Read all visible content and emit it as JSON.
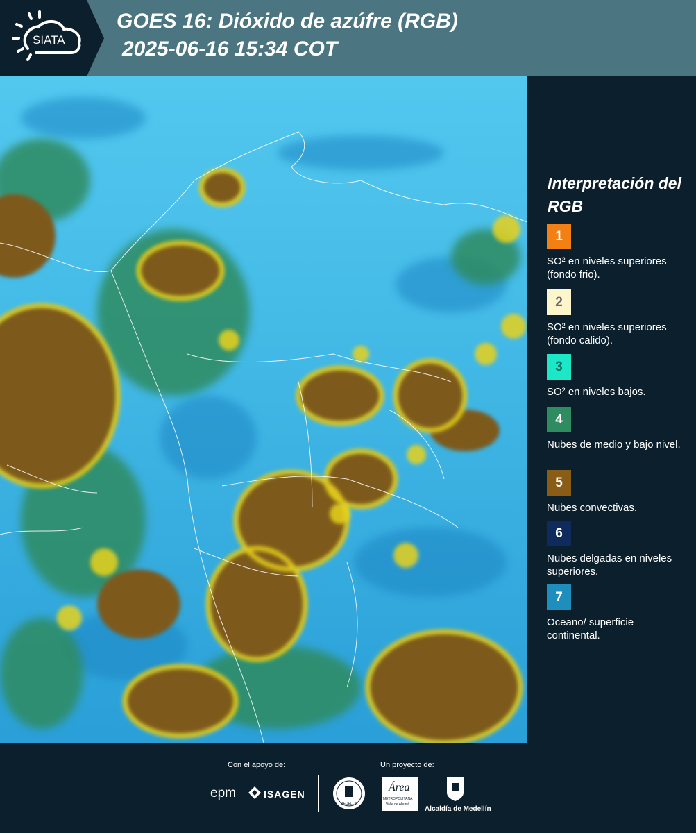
{
  "header": {
    "logo_text": "SIATA",
    "title_line1": "GOES 16: Dióxido de azúfre (RGB)",
    "title_line2": "2025-06-16 15:34 COT"
  },
  "legend": {
    "title": "Interpretación del RGB",
    "items": [
      {
        "number": "1",
        "color": "#f28014",
        "label": "SO² en niveles superiores (fondo frio)."
      },
      {
        "number": "2",
        "color": "#fdf6cc",
        "label": "SO² en niveles superiores (fondo calido)."
      },
      {
        "number": "3",
        "color": "#1ce8c8",
        "label": "SO² en niveles bajos."
      },
      {
        "number": "4",
        "color": "#2f8b60",
        "label": "Nubes de medio y bajo nivel."
      },
      {
        "number": "5",
        "color": "#8a5d16",
        "label": "Nubes convectivas."
      },
      {
        "number": "6",
        "color": "#0f2b5e",
        "label": "Nubes delgadas en niveles superiores."
      },
      {
        "number": "7",
        "color": "#1e8fbd",
        "label": "Oceano/ superficie continental."
      }
    ]
  },
  "footer": {
    "support_caption": "Con el apoyo de:",
    "project_caption": "Un proyecto de:",
    "sponsor_epm": "epm",
    "sponsor_isagen": "ISAGEN",
    "area_logo_text": "Área",
    "area_sub1": "METROPOLITANA",
    "area_sub2": "Valle de Aburrá",
    "alcaldia_label": "Alcaldía de Medellín",
    "seal_text": "MEDELLÍN"
  },
  "colors": {
    "header_bg": "#4b7580",
    "panel_bg": "#0b1f2c",
    "sea": "#3fb7e6",
    "cloud_yellow": "#e8d21f",
    "cloud_brown": "#8a6420",
    "cloud_green": "#2f8b60"
  }
}
